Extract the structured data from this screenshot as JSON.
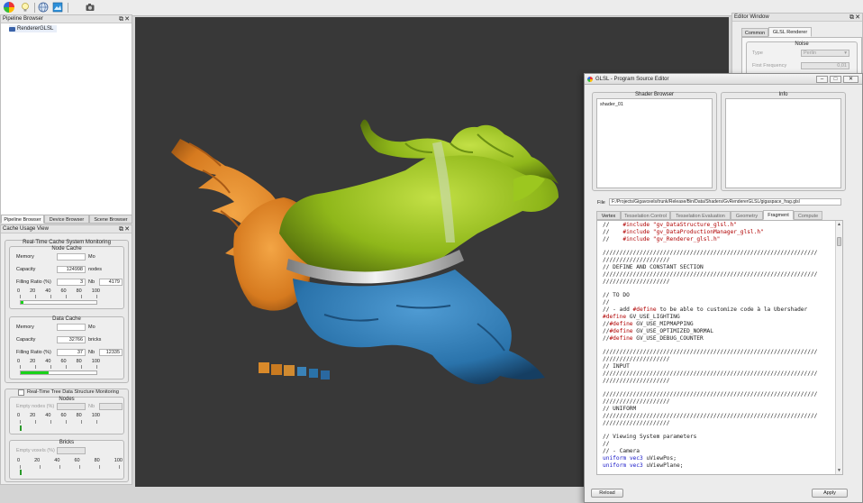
{
  "left_dock": {
    "pipeline_title": "Pipeline Browser",
    "tree_item": "RendererGLSL",
    "tabs": [
      "Pipeline Browser",
      "Device Browser",
      "Scene Browser"
    ],
    "cache_title": "Cache Usage View",
    "realtime_cache": {
      "title": "Real-Time Cache System Monitoring",
      "node_cache": {
        "title": "Node Cache",
        "memory_label": "Memory",
        "memory_value": "",
        "memory_unit": "Mo",
        "capacity_label": "Capacity",
        "capacity_value": "124998",
        "capacity_unit": "nodes",
        "fill_label": "Filling Ratio (%)",
        "fill_value": "3",
        "nb_label": "Nb",
        "nb_value": "4179",
        "ticks": [
          "0",
          "20",
          "40",
          "60",
          "80",
          "100"
        ],
        "fill_fraction": 0.03
      },
      "data_cache": {
        "title": "Data Cache",
        "memory_label": "Memory",
        "memory_value": "",
        "memory_unit": "Mo",
        "capacity_label": "Capacity",
        "capacity_value": "32766",
        "capacity_unit": "bricks",
        "fill_label": "Filling Ratio (%)",
        "fill_value": "37",
        "nb_label": "Nb",
        "nb_value": "12335",
        "ticks": [
          "0",
          "20",
          "40",
          "60",
          "80",
          "100"
        ],
        "fill_fraction": 0.37
      }
    },
    "tree_monitor": {
      "title": "Real-Time Tree Data Structure Monitoring",
      "nodes": {
        "title": "Nodes",
        "empty_label": "Empty nodes (%)",
        "nb_label": "Nb",
        "ticks": [
          "0",
          "20",
          "40",
          "60",
          "80",
          "100"
        ]
      },
      "bricks": {
        "title": "Bricks",
        "empty_label": "Empty voxels (%)",
        "ticks": [
          "0",
          "20",
          "40",
          "60",
          "80",
          "100"
        ]
      }
    }
  },
  "editor_window": {
    "title": "Editor Window",
    "tabs": [
      "Common",
      "GLSL Renderer"
    ],
    "noise_title": "Noise",
    "type_label": "Type",
    "type_value": "Perlin",
    "freq_label": "First Frequency",
    "freq_value": "0,01"
  },
  "source_editor": {
    "title": "GLSL - Program Source Editor",
    "shader_browser_title": "Shader Browser",
    "shader_item": "shader_01",
    "info_title": "Info",
    "file_label": "File",
    "file_path": "F:/Projects/Gigavoxels/trunk/Release/Bin/Data/Shaders/GvRendererGLSL/gigaspace_frag.glsl",
    "tabs": [
      "Vertex",
      "Tesselation Control",
      "Tesselation Evaluation",
      "Geometry",
      "Fragment",
      "Compute"
    ],
    "active_tab": "Fragment",
    "reload_label": "Reload",
    "apply_label": "Apply",
    "code_lines": [
      "//    #include \"gv_DataStructure_glsl.h\"",
      "//    #include \"gv_DataProductionManager_glsl.h\"",
      "//    #include \"gv_Renderer_glsl.h\"",
      "",
      "////////////////////////////////////////////////////////////////",
      "////////////////////",
      "// DEFINE AND CONSTANT SECTION",
      "////////////////////////////////////////////////////////////////",
      "////////////////////",
      "",
      "// TO DO",
      "//",
      "// - add #define to be able to customize code à la Ubershader",
      "#define GV_USE_LIGHTING",
      "//#define GV_USE_MIPMAPPING",
      "//#define GV_USE_OPTIMIZED_NORMAL",
      "//#define GV_USE_DEBUG_COUNTER",
      "",
      "////////////////////////////////////////////////////////////////",
      "////////////////////",
      "// INPUT",
      "////////////////////////////////////////////////////////////////",
      "////////////////////",
      "",
      "////////////////////////////////////////////////////////////////",
      "////////////////////",
      "// UNIFORM",
      "////////////////////////////////////////////////////////////////",
      "////////////////////",
      "",
      "// Viewing System parameters",
      "//",
      "// - Camera",
      "uniform vec3 uViewPos;",
      "uniform vec3 uViewPlane;"
    ]
  },
  "colors": {
    "viewport_bg": "#383838",
    "model_green": "#9cc71f",
    "model_orange": "#e08a2a",
    "model_blue": "#2a78b0",
    "progress_green": "#19d219",
    "code_preprocessor": "#b00000",
    "code_type": "#1515c8"
  },
  "icons": [
    "renderer-logo-icon",
    "lightbulb-icon",
    "globe-icon",
    "scene-icon",
    "camera-icon"
  ]
}
